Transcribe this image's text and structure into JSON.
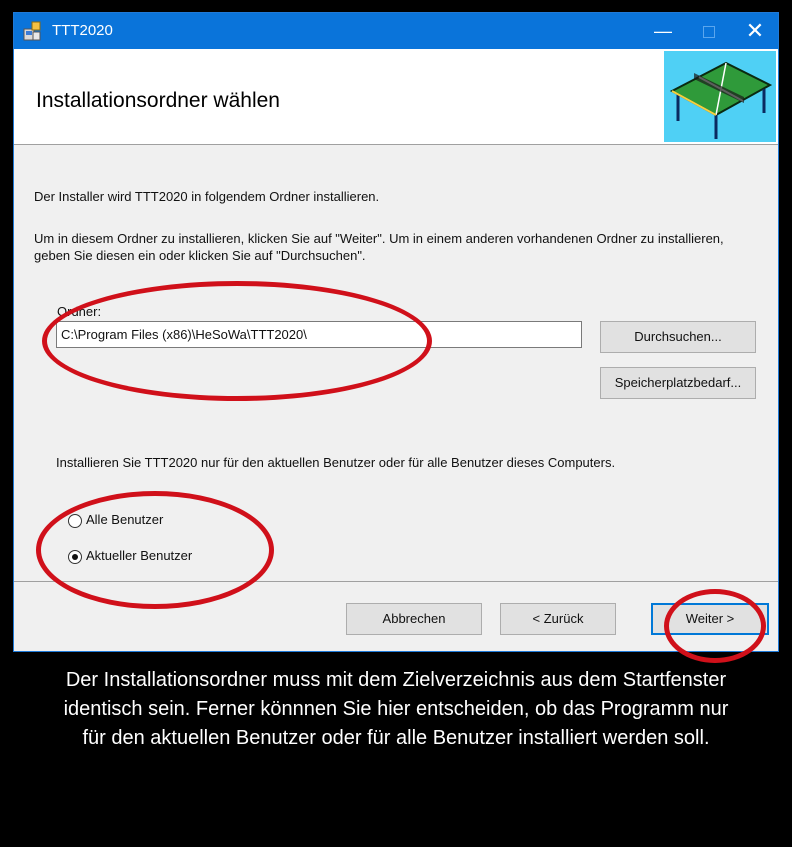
{
  "window": {
    "title": "TTT2020",
    "minimize": "—",
    "maximize": "",
    "close": "✕"
  },
  "banner": {
    "heading": "Installationsordner wählen"
  },
  "intro": "Der Installer wird TTT2020 in folgendem Ordner installieren.",
  "instructions": "Um in diesem Ordner zu installieren, klicken Sie auf \"Weiter\". Um in einem anderen vorhandenen Ordner zu installieren, geben Sie diesen ein oder klicken Sie auf \"Durchsuchen\".",
  "folder": {
    "label": "Ordner:",
    "value": "C:\\Program Files (x86)\\HeSoWa\\TTT2020\\"
  },
  "buttons": {
    "browse": "Durchsuchen...",
    "disk_space": "Speicherplatzbedarf...",
    "cancel": "Abbrechen",
    "back": "< Zurück",
    "next": "Weiter >"
  },
  "scope": {
    "question": "Installieren Sie TTT2020 nur für den aktuellen Benutzer oder für alle Benutzer dieses Computers.",
    "options": [
      {
        "label": "Alle Benutzer",
        "selected": false
      },
      {
        "label": "Aktueller Benutzer",
        "selected": true
      }
    ]
  },
  "caption": "Der Installationsordner muss mit dem Zielverzeichnis aus dem Startfenster identisch sein. Ferner könnnen Sie hier entscheiden, ob das Programm nur für den aktuellen Benutzer oder für alle Benutzer installiert werden soll.",
  "colors": {
    "titlebar": "#0a74da",
    "annotation": "#d0101a",
    "banner_graphic": "#4fd0f5"
  }
}
